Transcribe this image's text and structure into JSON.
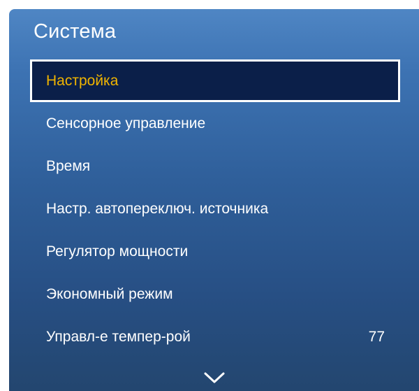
{
  "panel": {
    "title": "Система"
  },
  "menu": {
    "items": [
      {
        "label": "Настройка",
        "selected": true
      },
      {
        "label": "Сенсорное управление"
      },
      {
        "label": "Время"
      },
      {
        "label": "Настр. автопереключ. источника"
      },
      {
        "label": "Регулятор мощности"
      },
      {
        "label": "Экономный режим"
      },
      {
        "label": "Управл-е темпер-рой",
        "value": "77"
      }
    ]
  },
  "icons": {
    "scroll": "chevron-down-icon"
  },
  "colors": {
    "panel_top": "#4f86c4",
    "panel_bottom": "#23466f",
    "selected_bg": "#0b1f49",
    "selected_text": "#f0b400",
    "text": "#ffffff"
  }
}
